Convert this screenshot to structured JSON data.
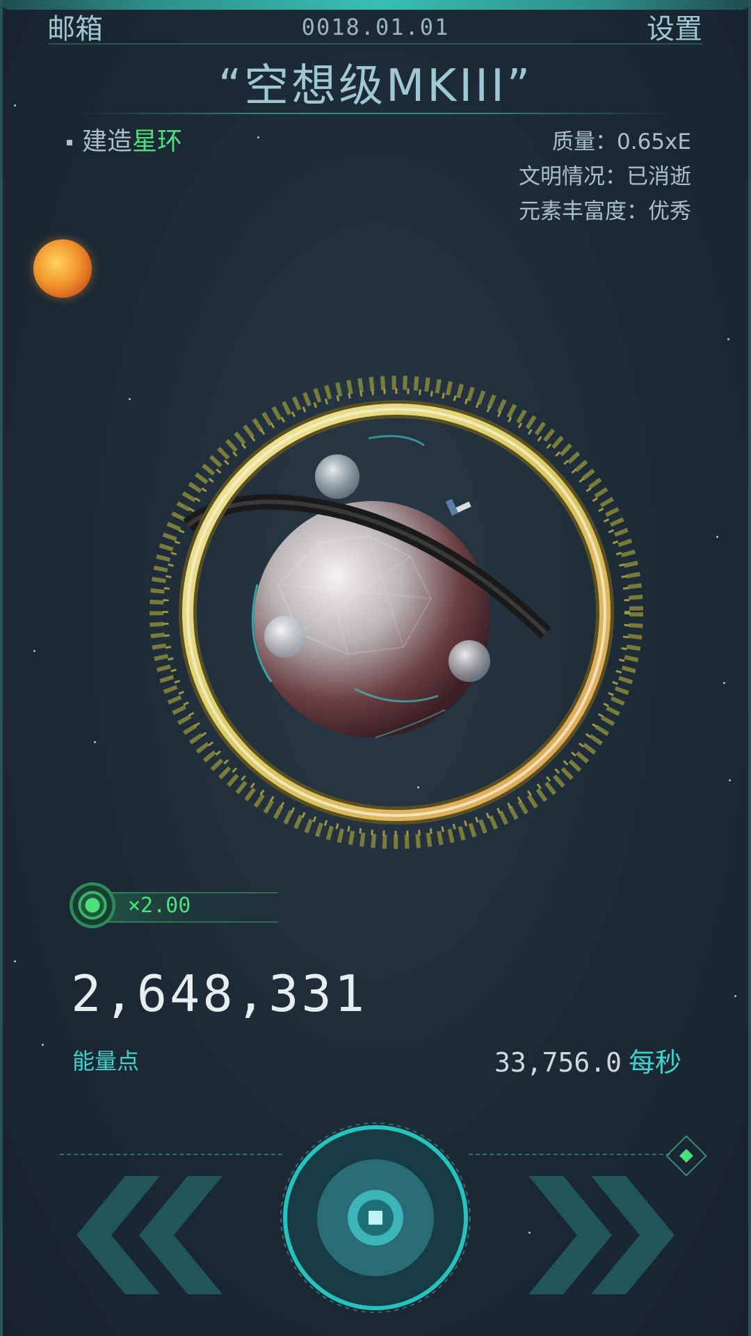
{
  "header": {
    "mail_label": "邮箱",
    "date": "0018.01.01",
    "settings_label": "设置",
    "planet_name": "“空想级MKIII”"
  },
  "info": {
    "build_prefix": "建造",
    "build_target": "星环",
    "mass": "质量：0.65xE",
    "civilization": "文明情况：已消逝",
    "element_abundance": "元素丰富度：优秀"
  },
  "multiplier": {
    "text": "×2.00"
  },
  "energy": {
    "value": "2,648,331",
    "label": "能量点",
    "rate": "33,756.0",
    "rate_unit": "每秒"
  },
  "controls": {
    "prev_icon": "double-chevron-left-icon",
    "next_icon": "double-chevron-right-icon",
    "center_icon": "stop-square-icon"
  },
  "colors": {
    "accent": "#3fd2cf",
    "green": "#4ee07d",
    "text": "#a9c0ca"
  }
}
